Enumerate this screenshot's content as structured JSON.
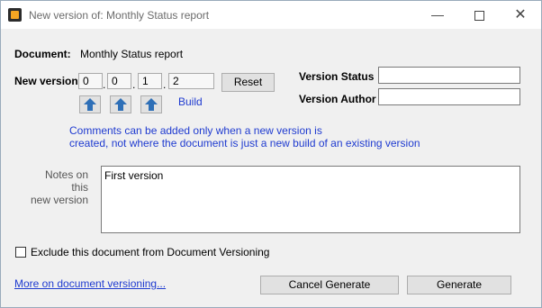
{
  "window": {
    "title": "New version of: Monthly Status report",
    "minimize_icon": "minimize-icon",
    "maximize_icon": "maximize-icon",
    "close_icon": "close-icon"
  },
  "document": {
    "label": "Document:",
    "value": "Monthly Status report"
  },
  "new_version": {
    "label": "New version",
    "parts": [
      "0",
      "0",
      "1",
      "2"
    ],
    "separator": ".",
    "reset_label": "Reset",
    "build_label": "Build",
    "up_icon": "arrow-up-icon"
  },
  "version_status": {
    "label": "Version Status",
    "value": ""
  },
  "version_author": {
    "label": "Version Author",
    "value": ""
  },
  "comment_note": {
    "line1": "Comments can be added only when a new version is",
    "line2": "created, not where the document is just a new build of an existing version"
  },
  "notes": {
    "label_line1": "Notes on this",
    "label_line2": "new version",
    "value": "First version"
  },
  "exclude": {
    "label": "Exclude this document from Document Versioning",
    "checked": false
  },
  "footer": {
    "more_link": "More on document versioning...",
    "cancel_label": "Cancel Generate",
    "generate_label": "Generate"
  },
  "colors": {
    "accent_blue": "#1f3bd0",
    "arrow_blue": "#2e6fb7"
  }
}
